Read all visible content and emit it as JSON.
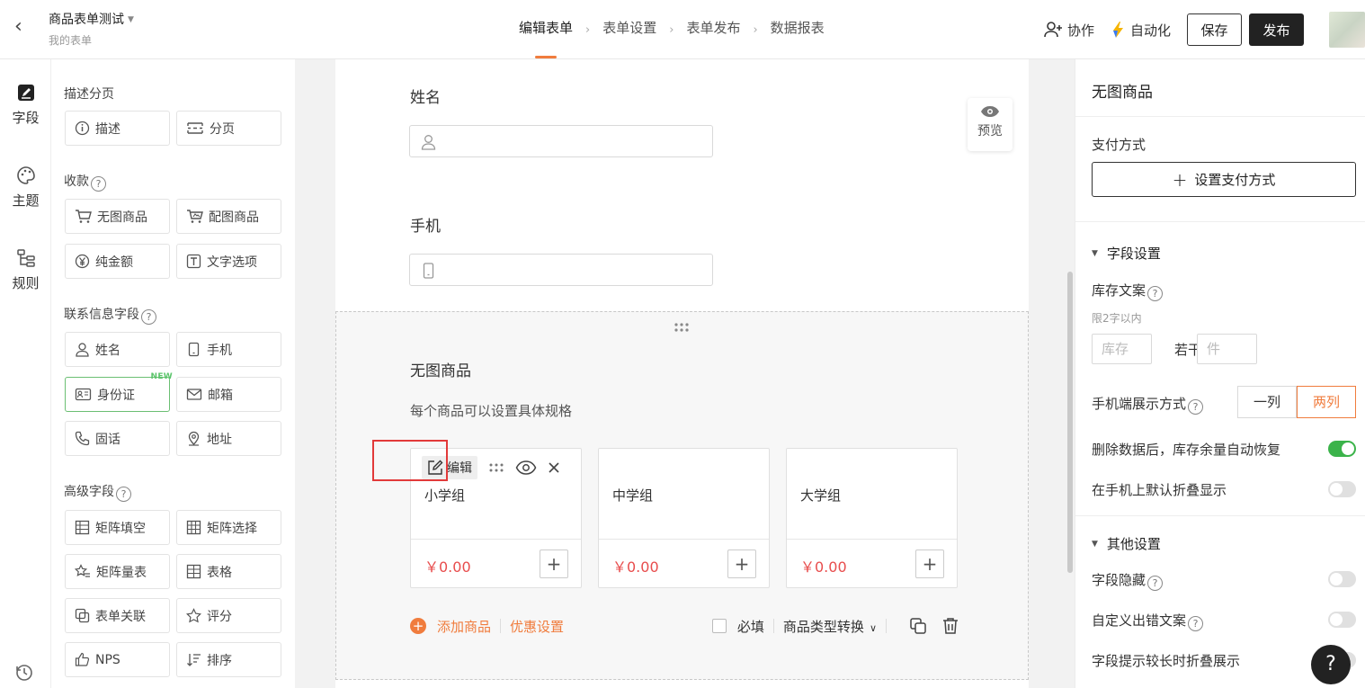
{
  "header": {
    "back_label": "‹",
    "title": "商品表单测试",
    "subtitle": "我的表单",
    "steps": [
      "编辑表单",
      "表单设置",
      "表单发布",
      "数据报表"
    ],
    "collab_label": "协作",
    "auto_label": "自动化",
    "save_label": "保存",
    "publish_label": "发布"
  },
  "rail": {
    "items": [
      "字段",
      "主题",
      "规则"
    ]
  },
  "palette": {
    "sections": [
      "描述分页",
      "收款",
      "联系信息字段",
      "高级字段"
    ],
    "help_glyph": "?",
    "new_tag": "NEW",
    "items": {
      "desc": "描述",
      "page": "分页",
      "no_img_goods": "无图商品",
      "img_goods": "配图商品",
      "amount": "纯金额",
      "text_option": "文字选项",
      "name": "姓名",
      "phone": "手机",
      "idcard": "身份证",
      "email": "邮箱",
      "landline": "固话",
      "address": "地址",
      "matrix_fill": "矩阵填空",
      "matrix_select": "矩阵选择",
      "matrix_scale": "矩阵量表",
      "table": "表格",
      "form_link": "表单关联",
      "rating": "评分",
      "nps": "NPS",
      "sort": "排序"
    }
  },
  "canvas": {
    "name_label": "姓名",
    "phone_label": "手机",
    "preview_label": "预览",
    "goods_title": "无图商品",
    "goods_desc": "每个商品可以设置具体规格",
    "edit_label": "编辑",
    "goods": [
      {
        "name": "小学组",
        "price": "￥0.00"
      },
      {
        "name": "中学组",
        "price": "￥0.00"
      },
      {
        "name": "大学组",
        "price": "￥0.00"
      }
    ],
    "add_glyph": "+",
    "add_goods_label": "添加商品",
    "discount_label": "优惠设置",
    "required_label": "必填",
    "convert_label": "商品类型转换"
  },
  "right_panel": {
    "title": "无图商品",
    "pay_label": "支付方式",
    "pay_btn_label": "设置支付方式",
    "field_settings": "字段设置",
    "stock_label": "库存文案",
    "stock_hint": "限2字以内",
    "stock_placeholder": "库存",
    "ruogan": "若干",
    "unit_placeholder": "件",
    "mobile_display_label": "手机端展示方式",
    "mobile_options": [
      "一列",
      "两列"
    ],
    "mobile_selected": "两列",
    "restore_label": "删除数据后，库存余量自动恢复",
    "restore_on": true,
    "collapse_label": "在手机上默认折叠显示",
    "collapse_on": false,
    "other_settings": "其他设置",
    "hide_label": "字段隐藏",
    "custom_error_label": "自定义出错文案",
    "long_hint_label": "字段提示较长时折叠展示",
    "help_glyph": "?"
  },
  "colors": {
    "accent": "#f07c3d",
    "price": "#e84d4d",
    "toggle_on": "#3bb34a",
    "highlight_box": "#e23a3a"
  }
}
